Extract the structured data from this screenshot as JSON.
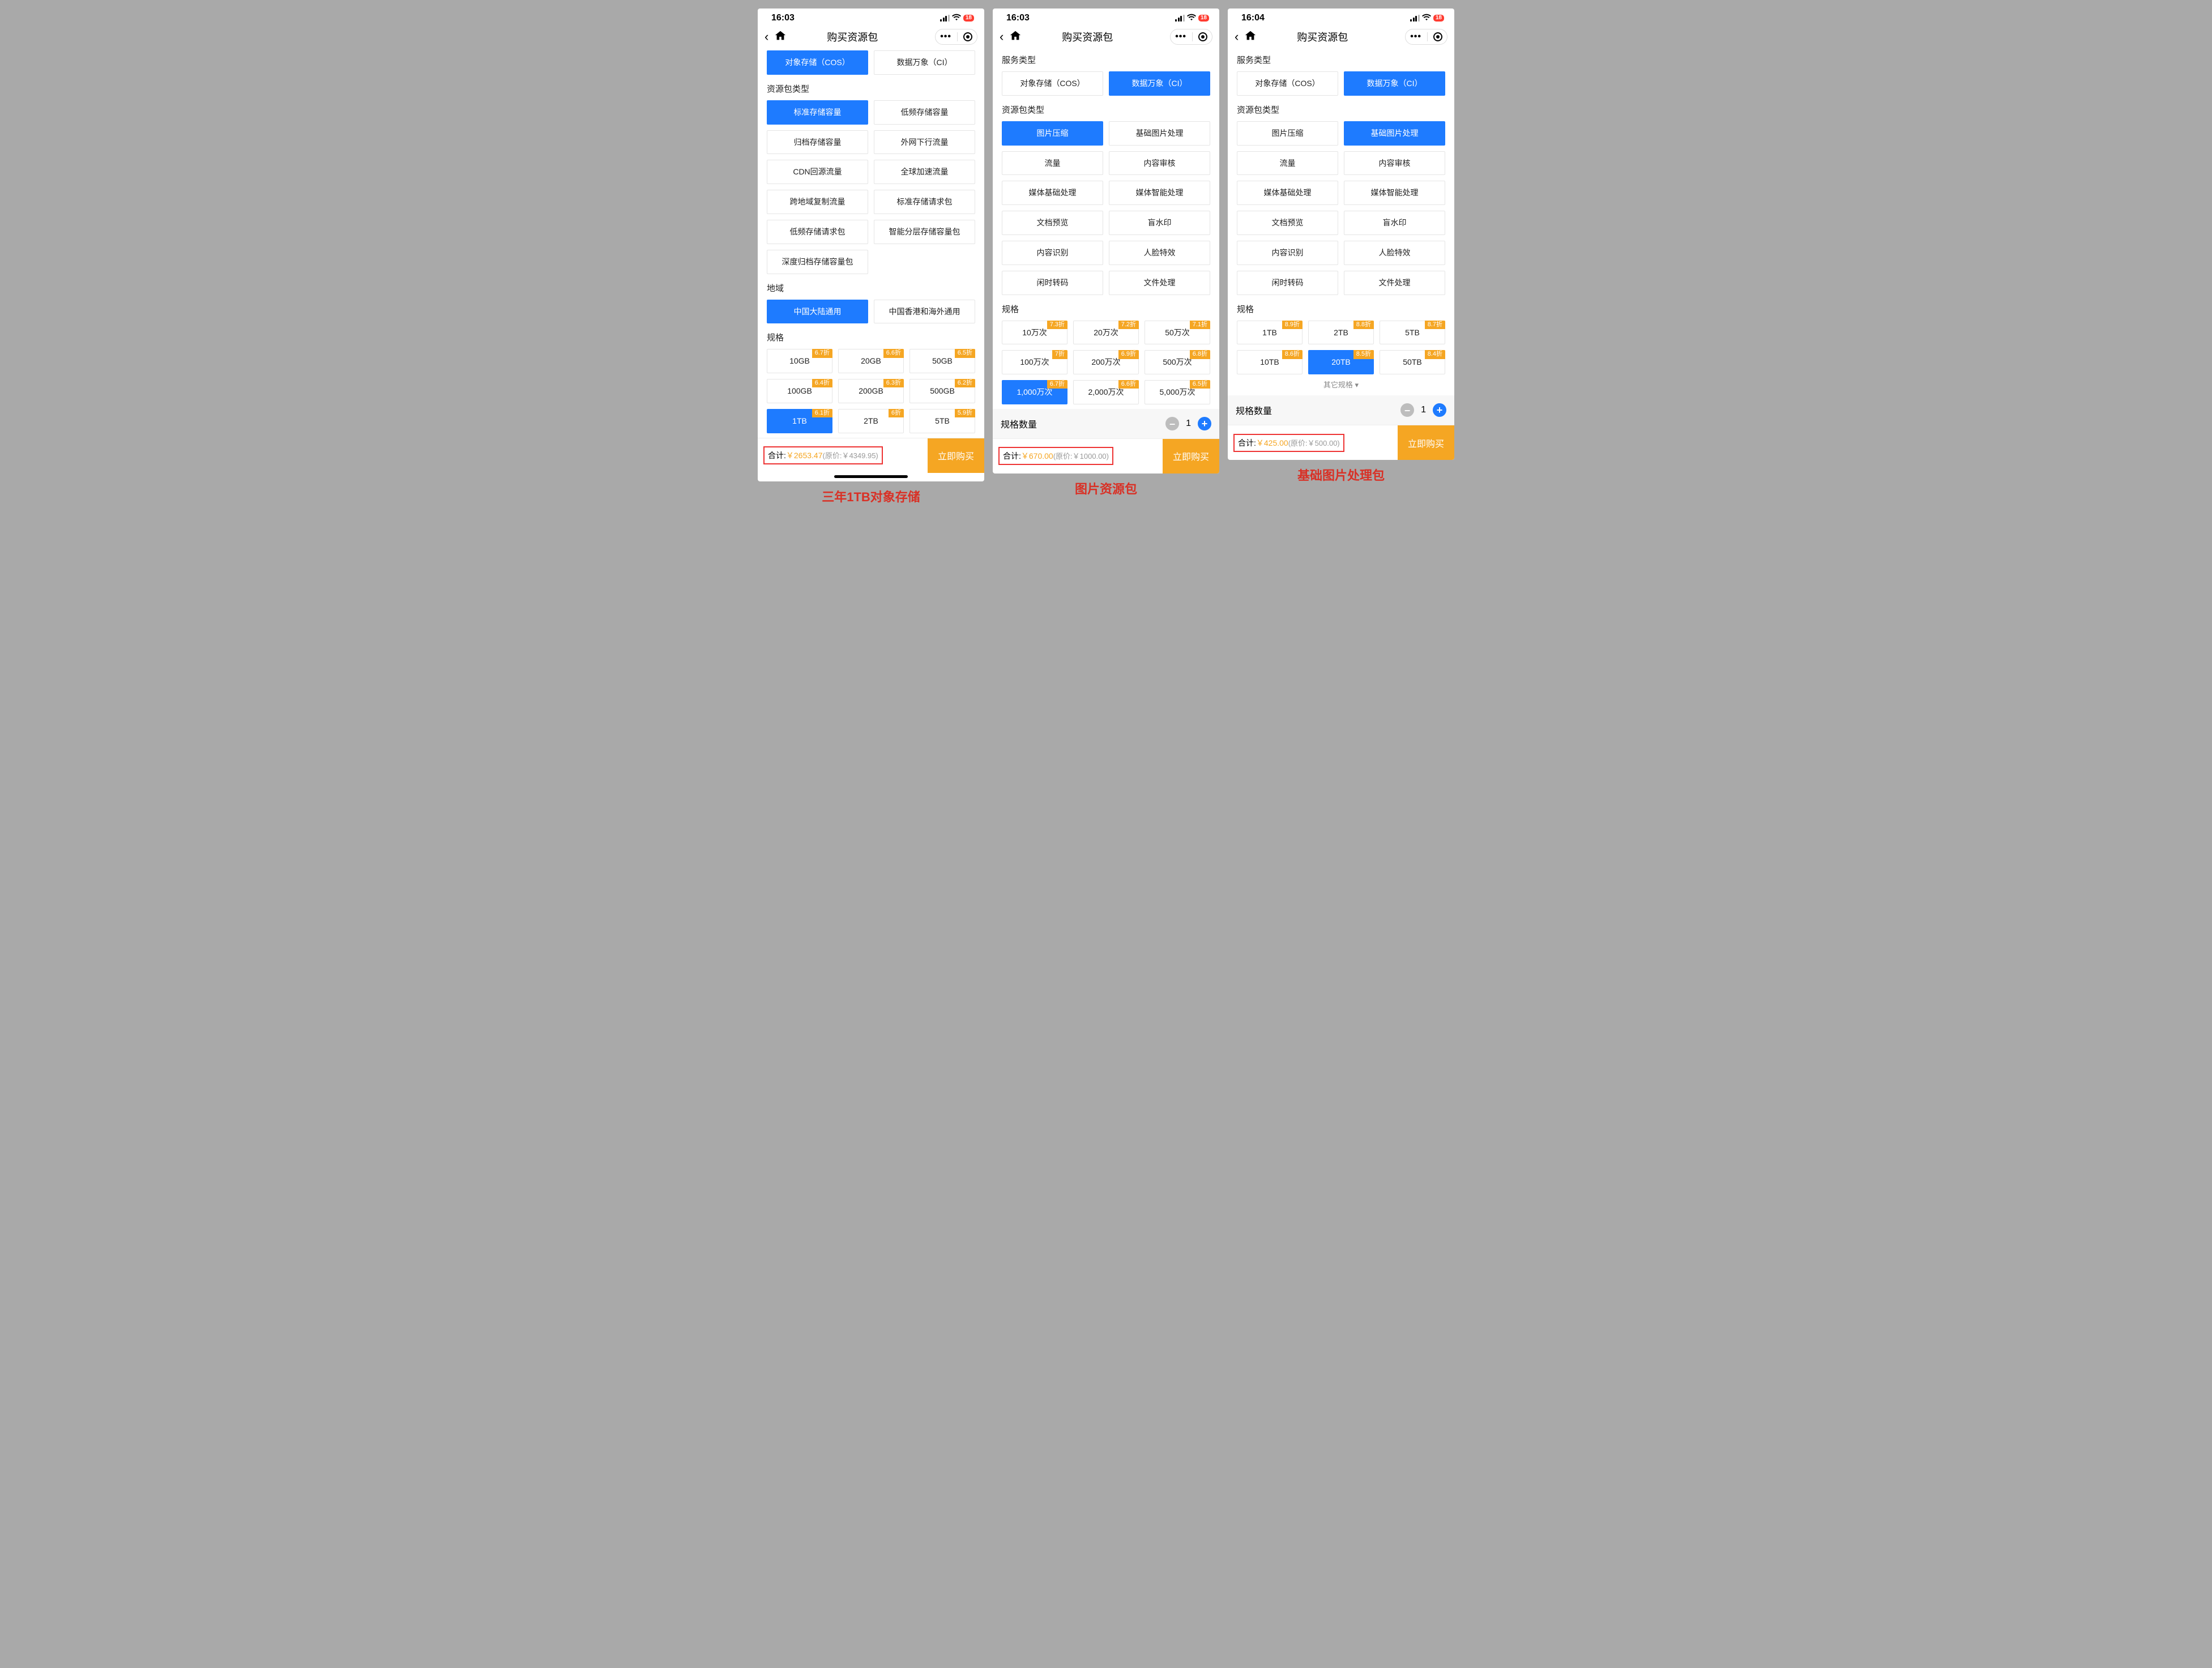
{
  "screens": [
    {
      "time": "16:03",
      "battery": "18",
      "title": "购买资源包",
      "service_label": null,
      "service": [
        {
          "label": "对象存储（COS）",
          "sel": true
        },
        {
          "label": "数据万象（CI）",
          "sel": false
        }
      ],
      "pkg_label": "资源包类型",
      "pkg_cols": 2,
      "pkg": [
        {
          "label": "标准存储容量",
          "sel": true
        },
        {
          "label": "低频存储容量"
        },
        {
          "label": "归档存储容量"
        },
        {
          "label": "外网下行流量"
        },
        {
          "label": "CDN回源流量"
        },
        {
          "label": "全球加速流量"
        },
        {
          "label": "跨地域复制流量"
        },
        {
          "label": "标准存储请求包"
        },
        {
          "label": "低频存储请求包"
        },
        {
          "label": "智能分层存储容量包"
        },
        {
          "label": "深度归档存储容量包"
        }
      ],
      "region_label": "地域",
      "region": [
        {
          "label": "中国大陆通用",
          "sel": true
        },
        {
          "label": "中国香港和海外通用"
        }
      ],
      "spec_label": "规格",
      "spec": [
        {
          "label": "10GB",
          "tag": "6.7折"
        },
        {
          "label": "20GB",
          "tag": "6.6折"
        },
        {
          "label": "50GB",
          "tag": "6.5折"
        },
        {
          "label": "100GB",
          "tag": "6.4折"
        },
        {
          "label": "200GB",
          "tag": "6.3折"
        },
        {
          "label": "500GB",
          "tag": "6.2折"
        },
        {
          "label": "1TB",
          "tag": "6.1折",
          "sel": true
        },
        {
          "label": "2TB",
          "tag": "6折"
        },
        {
          "label": "5TB",
          "tag": "5.9折"
        }
      ],
      "show_other": false,
      "qty_label": null,
      "qty": null,
      "total_label": "合计:",
      "total_price": "￥2653.47",
      "total_orig": "(原价:￥4349.95)",
      "buy": "立即购买",
      "homebar": true,
      "caption": "三年1TB对象存储"
    },
    {
      "time": "16:03",
      "battery": "18",
      "title": "购买资源包",
      "service_label": "服务类型",
      "service": [
        {
          "label": "对象存储（COS）"
        },
        {
          "label": "数据万象（CI）",
          "sel": true
        }
      ],
      "pkg_label": "资源包类型",
      "pkg_cols": 2,
      "pkg": [
        {
          "label": "图片压缩",
          "sel": true
        },
        {
          "label": "基础图片处理"
        },
        {
          "label": "流量"
        },
        {
          "label": "内容审核"
        },
        {
          "label": "媒体基础处理"
        },
        {
          "label": "媒体智能处理"
        },
        {
          "label": "文档预览"
        },
        {
          "label": "盲水印"
        },
        {
          "label": "内容识别"
        },
        {
          "label": "人脸特效"
        },
        {
          "label": "闲时转码"
        },
        {
          "label": "文件处理"
        }
      ],
      "spec_label": "规格",
      "spec": [
        {
          "label": "10万次",
          "tag": "7.3折"
        },
        {
          "label": "20万次",
          "tag": "7.2折"
        },
        {
          "label": "50万次",
          "tag": "7.1折"
        },
        {
          "label": "100万次",
          "tag": "7折"
        },
        {
          "label": "200万次",
          "tag": "6.9折"
        },
        {
          "label": "500万次",
          "tag": "6.8折"
        },
        {
          "label": "1,000万次",
          "tag": "6.7折",
          "sel": true
        },
        {
          "label": "2,000万次",
          "tag": "6.6折"
        },
        {
          "label": "5,000万次",
          "tag": "6.5折"
        }
      ],
      "show_other": false,
      "qty_label": "规格数量",
      "qty": "1",
      "total_label": "合计:",
      "total_price": "￥670.00",
      "total_orig": "(原价:￥1000.00)",
      "buy": "立即购买",
      "homebar": false,
      "caption": "图片资源包"
    },
    {
      "time": "16:04",
      "battery": "18",
      "title": "购买资源包",
      "service_label": "服务类型",
      "service": [
        {
          "label": "对象存储（COS）"
        },
        {
          "label": "数据万象（CI）",
          "sel": true
        }
      ],
      "pkg_label": "资源包类型",
      "pkg_cols": 2,
      "pkg": [
        {
          "label": "图片压缩"
        },
        {
          "label": "基础图片处理",
          "sel": true
        },
        {
          "label": "流量"
        },
        {
          "label": "内容审核"
        },
        {
          "label": "媒体基础处理"
        },
        {
          "label": "媒体智能处理"
        },
        {
          "label": "文档预览"
        },
        {
          "label": "盲水印"
        },
        {
          "label": "内容识别"
        },
        {
          "label": "人脸特效"
        },
        {
          "label": "闲时转码"
        },
        {
          "label": "文件处理"
        }
      ],
      "spec_label": "规格",
      "spec": [
        {
          "label": "1TB",
          "tag": "8.9折"
        },
        {
          "label": "2TB",
          "tag": "8.8折"
        },
        {
          "label": "5TB",
          "tag": "8.7折"
        },
        {
          "label": "10TB",
          "tag": "8.6折"
        },
        {
          "label": "20TB",
          "tag": "8.5折",
          "sel": true
        },
        {
          "label": "50TB",
          "tag": "8.4折"
        }
      ],
      "show_other": true,
      "other_label": "其它规格 ▾",
      "qty_label": "规格数量",
      "qty": "1",
      "total_label": "合计:",
      "total_price": "￥425.00",
      "total_orig": "(原价:￥500.00)",
      "buy": "立即购买",
      "homebar": false,
      "caption": "基础图片处理包"
    }
  ]
}
